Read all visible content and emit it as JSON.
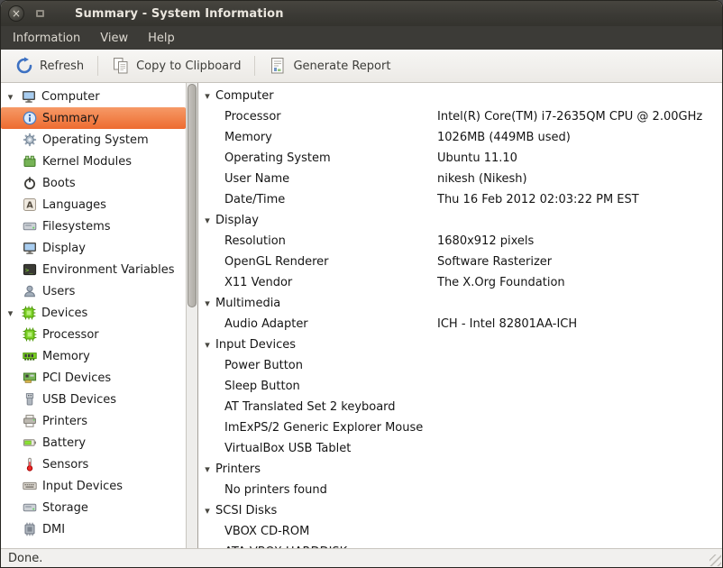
{
  "window": {
    "title": "Summary - System Information",
    "controls": [
      {
        "icon": "close-icon"
      },
      {
        "icon": "maximize-icon"
      }
    ]
  },
  "menubar": {
    "items": [
      "Information",
      "View",
      "Help"
    ]
  },
  "toolbar": {
    "buttons": [
      {
        "label": "Refresh",
        "icon": "refresh-icon"
      },
      {
        "label": "Copy to Clipboard",
        "icon": "copy-icon"
      },
      {
        "label": "Generate Report",
        "icon": "report-icon"
      }
    ]
  },
  "sidebar": {
    "items": [
      {
        "label": "Computer",
        "icon": "computer-icon",
        "level": 0,
        "expander": true,
        "selected": false
      },
      {
        "label": "Summary",
        "icon": "info-icon",
        "level": 1,
        "expander": false,
        "selected": true
      },
      {
        "label": "Operating System",
        "icon": "gear-icon",
        "level": 1,
        "expander": false,
        "selected": false
      },
      {
        "label": "Kernel Modules",
        "icon": "module-icon",
        "level": 1,
        "expander": false,
        "selected": false
      },
      {
        "label": "Boots",
        "icon": "power-icon",
        "level": 1,
        "expander": false,
        "selected": false
      },
      {
        "label": "Languages",
        "icon": "language-icon",
        "level": 1,
        "expander": false,
        "selected": false
      },
      {
        "label": "Filesystems",
        "icon": "drive-icon",
        "level": 1,
        "expander": false,
        "selected": false
      },
      {
        "label": "Display",
        "icon": "display-icon",
        "level": 1,
        "expander": false,
        "selected": false
      },
      {
        "label": "Environment Variables",
        "icon": "terminal-icon",
        "level": 1,
        "expander": false,
        "selected": false
      },
      {
        "label": "Users",
        "icon": "users-icon",
        "level": 1,
        "expander": false,
        "selected": false
      },
      {
        "label": "Devices",
        "icon": "chip-icon",
        "level": 0,
        "expander": true,
        "selected": false
      },
      {
        "label": "Processor",
        "icon": "processor-icon",
        "level": 1,
        "expander": false,
        "selected": false
      },
      {
        "label": "Memory",
        "icon": "memory-icon",
        "level": 1,
        "expander": false,
        "selected": false
      },
      {
        "label": "PCI Devices",
        "icon": "pci-icon",
        "level": 1,
        "expander": false,
        "selected": false
      },
      {
        "label": "USB Devices",
        "icon": "usb-icon",
        "level": 1,
        "expander": false,
        "selected": false
      },
      {
        "label": "Printers",
        "icon": "printer-icon",
        "level": 1,
        "expander": false,
        "selected": false
      },
      {
        "label": "Battery",
        "icon": "battery-icon",
        "level": 1,
        "expander": false,
        "selected": false
      },
      {
        "label": "Sensors",
        "icon": "sensor-icon",
        "level": 1,
        "expander": false,
        "selected": false
      },
      {
        "label": "Input Devices",
        "icon": "keyboard-icon",
        "level": 1,
        "expander": false,
        "selected": false
      },
      {
        "label": "Storage",
        "icon": "storage-icon",
        "level": 1,
        "expander": false,
        "selected": false
      },
      {
        "label": "DMI",
        "icon": "dmi-icon",
        "level": 1,
        "expander": false,
        "selected": false
      }
    ]
  },
  "main": {
    "rows": [
      {
        "label": "Computer",
        "value": "",
        "section": true
      },
      {
        "label": "Processor",
        "value": "Intel(R) Core(TM) i7-2635QM CPU @ 2.00GHz",
        "section": false
      },
      {
        "label": "Memory",
        "value": "1026MB (449MB used)",
        "section": false
      },
      {
        "label": "Operating System",
        "value": "Ubuntu 11.10",
        "section": false
      },
      {
        "label": "User Name",
        "value": "nikesh (Nikesh)",
        "section": false
      },
      {
        "label": "Date/Time",
        "value": "Thu 16 Feb 2012 02:03:22 PM EST",
        "section": false
      },
      {
        "label": "Display",
        "value": "",
        "section": true
      },
      {
        "label": "Resolution",
        "value": "1680x912 pixels",
        "section": false
      },
      {
        "label": "OpenGL Renderer",
        "value": "Software Rasterizer",
        "section": false
      },
      {
        "label": "X11 Vendor",
        "value": "The X.Org Foundation",
        "section": false
      },
      {
        "label": "Multimedia",
        "value": "",
        "section": true
      },
      {
        "label": "Audio Adapter",
        "value": "ICH - Intel 82801AA-ICH",
        "section": false
      },
      {
        "label": "Input Devices",
        "value": "",
        "section": true
      },
      {
        "label": "Power Button",
        "value": "",
        "section": false
      },
      {
        "label": "Sleep Button",
        "value": "",
        "section": false
      },
      {
        "label": "AT Translated Set 2 keyboard",
        "value": "",
        "section": false
      },
      {
        "label": "ImExPS/2 Generic Explorer Mouse",
        "value": "",
        "section": false
      },
      {
        "label": "VirtualBox USB Tablet",
        "value": "",
        "section": false
      },
      {
        "label": "Printers",
        "value": "",
        "section": true
      },
      {
        "label": "No printers found",
        "value": "",
        "section": false
      },
      {
        "label": "SCSI Disks",
        "value": "",
        "section": true
      },
      {
        "label": "VBOX CD-ROM",
        "value": "",
        "section": false
      },
      {
        "label": "ATA VBOX HARDDISK",
        "value": "",
        "section": false
      }
    ]
  },
  "statusbar": {
    "text": "Done."
  },
  "colors": {
    "titlebar_bg": "#3C3B37",
    "selection_orange": "#F07746",
    "toolbar_bg": "#F0EFEC",
    "accent_blue": "#3D71C2",
    "chip_green": "#73D216"
  }
}
